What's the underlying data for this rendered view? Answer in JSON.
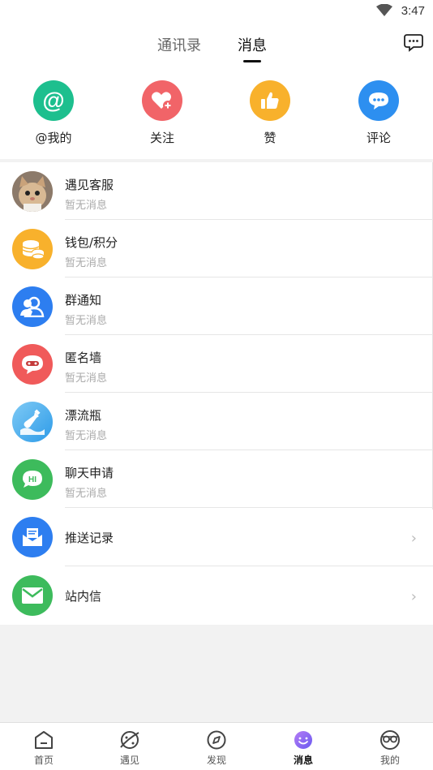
{
  "status_bar": {
    "time": "3:47"
  },
  "header": {
    "tabs": [
      {
        "label": "通讯录"
      },
      {
        "label": "消息"
      }
    ]
  },
  "quick_actions": [
    {
      "label": "@我的",
      "icon": "at-icon",
      "color": "#1dbf8e"
    },
    {
      "label": "关注",
      "icon": "heart-plus-icon",
      "color": "#f16468"
    },
    {
      "label": "赞",
      "icon": "thumbs-up-icon",
      "color": "#f8b12c"
    },
    {
      "label": "评论",
      "icon": "comment-icon",
      "color": "#2d8ff0"
    }
  ],
  "message_list": [
    {
      "title": "遇见客服",
      "subtitle": "暂无消息",
      "icon": "cat-avatar"
    },
    {
      "title": "钱包/积分",
      "subtitle": "暂无消息",
      "icon": "coins-icon",
      "color": "#f8b12c"
    },
    {
      "title": "群通知",
      "subtitle": "暂无消息",
      "icon": "group-icon",
      "color": "#2d7ef0"
    },
    {
      "title": "匿名墙",
      "subtitle": "暂无消息",
      "icon": "mask-bubble-icon",
      "color": "#f05a5a"
    },
    {
      "title": "漂流瓶",
      "subtitle": "暂无消息",
      "icon": "bottle-icon",
      "color": "#46aef0"
    },
    {
      "title": "聊天申请",
      "subtitle": "暂无消息",
      "icon": "hi-bubble-icon",
      "color": "#3dbb5c"
    },
    {
      "title": "推送记录",
      "icon": "push-mail-icon",
      "color": "#2d7ef0"
    },
    {
      "title": "站内信",
      "icon": "envelope-icon",
      "color": "#3dbb5c"
    }
  ],
  "tab_bar": [
    {
      "label": "首页",
      "icon": "home-icon"
    },
    {
      "label": "遇见",
      "icon": "planet-icon"
    },
    {
      "label": "发现",
      "icon": "compass-icon"
    },
    {
      "label": "消息",
      "icon": "smile-icon",
      "active": true
    },
    {
      "label": "我的",
      "icon": "glasses-face-icon"
    }
  ]
}
